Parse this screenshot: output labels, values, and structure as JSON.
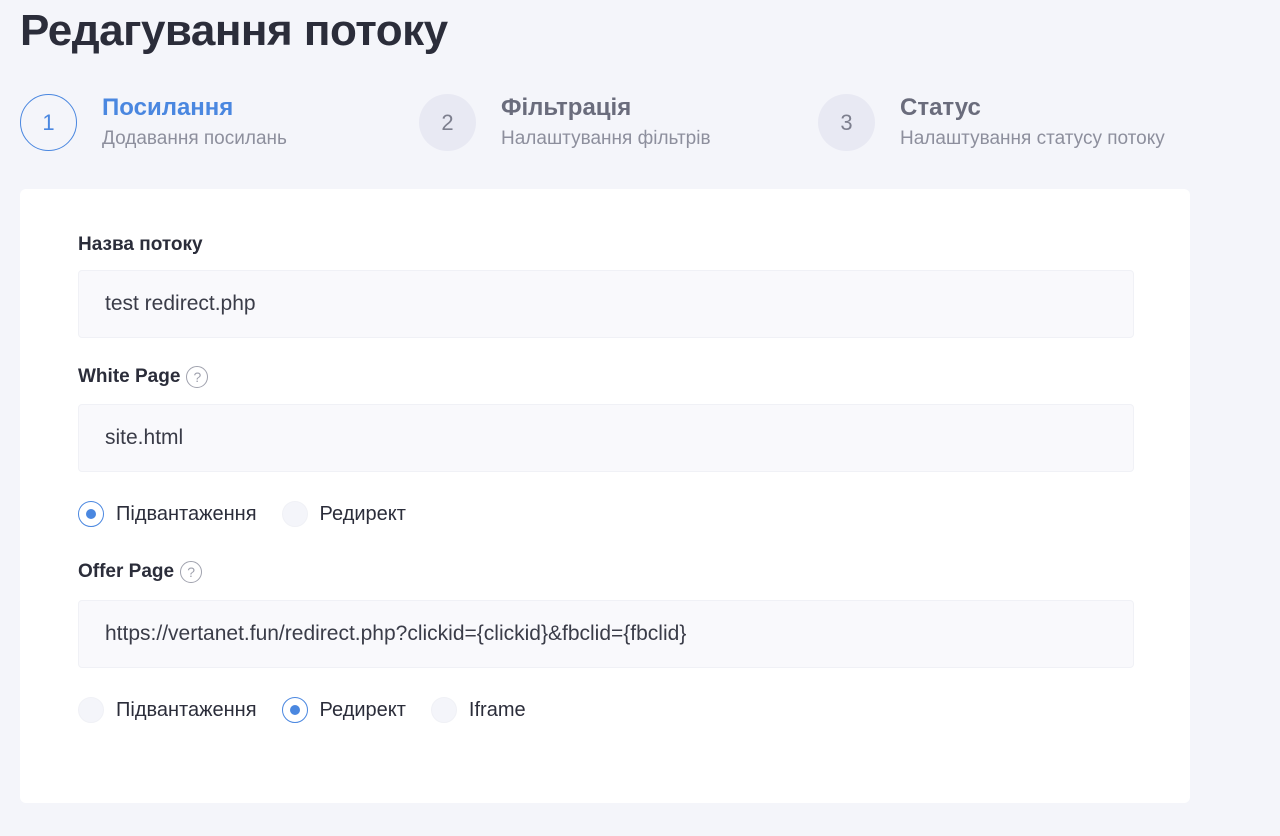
{
  "page_title": "Редагування потоку",
  "steps": [
    {
      "number": "1",
      "title": "Посилання",
      "subtitle": "Додавання посилань",
      "active": true
    },
    {
      "number": "2",
      "title": "Фільтрація",
      "subtitle": "Налаштування фільтрів",
      "active": false
    },
    {
      "number": "3",
      "title": "Статус",
      "subtitle": "Налаштування статусу потоку",
      "active": false
    }
  ],
  "form": {
    "stream_name": {
      "label": "Назва потоку",
      "value": "test redirect.php"
    },
    "white_page": {
      "label": "White Page",
      "help_icon": "?",
      "value": "site.html",
      "options": [
        "Підвантаження",
        "Редирект"
      ],
      "selected": "Підвантаження"
    },
    "offer_page": {
      "label": "Offer Page",
      "help_icon": "?",
      "value": "https://vertanet.fun/redirect.php?clickid={clickid}&fbclid={fbclid}",
      "options": [
        "Підвантаження",
        "Редирект",
        "Iframe"
      ],
      "selected": "Редирект"
    }
  },
  "colors": {
    "accent": "#4a87e0",
    "background": "#f4f5fa",
    "card": "#ffffff",
    "text": "#2b2d3a"
  }
}
